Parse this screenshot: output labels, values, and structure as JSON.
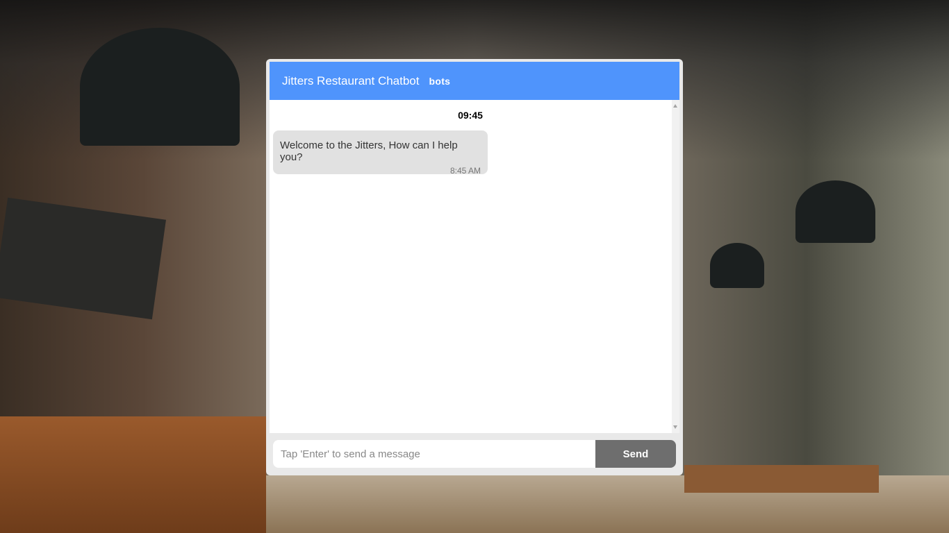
{
  "header": {
    "title": "Jitters Restaurant Chatbot",
    "logo": "bots"
  },
  "conversation": {
    "date_time": "09:45",
    "messages": [
      {
        "text": "Welcome to the Jitters, How can I help you?",
        "time": "8:45 AM",
        "sender": "bot"
      }
    ]
  },
  "composer": {
    "placeholder": "Tap 'Enter' to send a message",
    "value": "",
    "send_label": "Send"
  },
  "colors": {
    "header": "#4f94fc",
    "send_button": "#6e6e6e",
    "bubble": "#e1e1e1"
  }
}
